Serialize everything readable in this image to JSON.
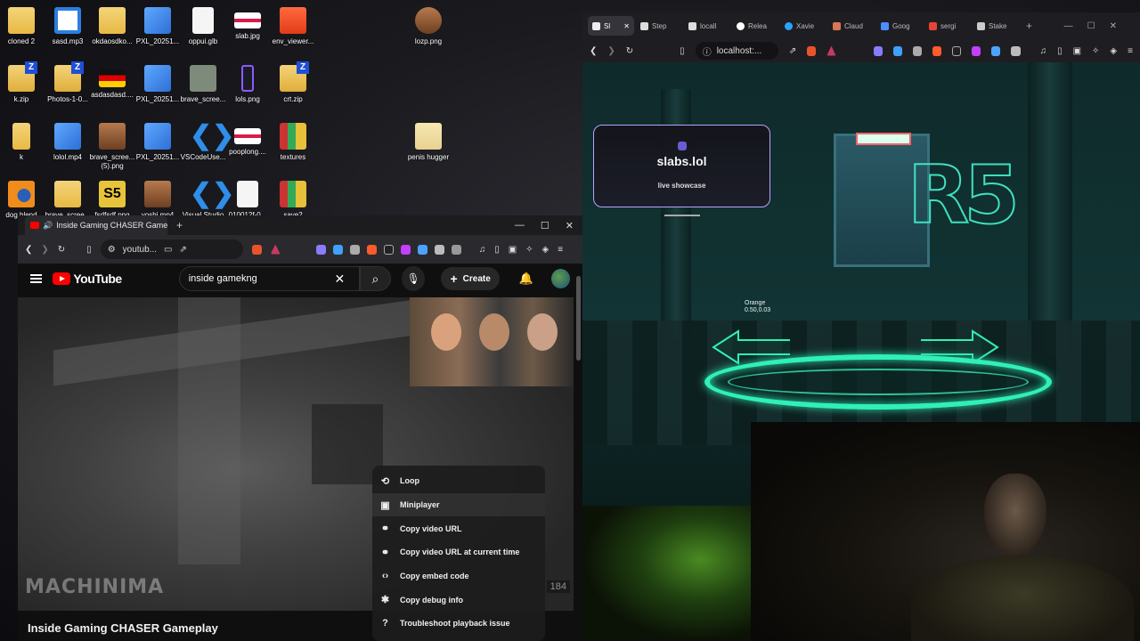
{
  "desktop": {
    "icons": [
      {
        "label": "cloned 2",
        "icon": "folder-icon"
      },
      {
        "label": "sasd.mp3",
        "icon": "audio-icon"
      },
      {
        "label": "okdaosdko...",
        "icon": "file-icon"
      },
      {
        "label": "PXL_20251...",
        "icon": "image-icon"
      },
      {
        "label": "oppui.glb",
        "icon": "file-icon"
      },
      {
        "label": "slab.jpg",
        "icon": "image-icon"
      },
      {
        "label": "env_viewer...",
        "icon": "brave-icon"
      },
      {
        "label": "lozp.png",
        "icon": "image-icon"
      },
      {
        "label": "k.zip",
        "icon": "zip-icon"
      },
      {
        "label": "Photos-1-0...",
        "icon": "zip-icon"
      },
      {
        "label": "asdasdasd....",
        "icon": "image-icon"
      },
      {
        "label": "PXL_20251...",
        "icon": "image-icon"
      },
      {
        "label": "brave_scree...",
        "icon": "image-icon"
      },
      {
        "label": "lols.png",
        "icon": "image-icon"
      },
      {
        "label": "crt.zip",
        "icon": "zip-icon"
      },
      {
        "label": "k",
        "icon": "file-icon"
      },
      {
        "label": "lolol.mp4",
        "icon": "image-icon"
      },
      {
        "label": "brave_scree...\n(5).png",
        "icon": "image-icon"
      },
      {
        "label": "PXL_20251...",
        "icon": "image-icon"
      },
      {
        "label": "VSCodeUse...",
        "icon": "vscode-icon"
      },
      {
        "label": "pooplong....",
        "icon": "image-icon"
      },
      {
        "label": "textures",
        "icon": "folder-icon"
      },
      {
        "label": "penis hugger",
        "icon": "folder-icon"
      },
      {
        "label": "dog.blend",
        "icon": "blender-icon"
      },
      {
        "label": "brave_scree...",
        "icon": "image-icon"
      },
      {
        "label": "fsdfsdf.png",
        "icon": "image-icon"
      },
      {
        "label": "yoshi.mp4",
        "icon": "image-icon"
      },
      {
        "label": "Visual Studio",
        "icon": "vscode-icon"
      },
      {
        "label": "010012f-0...",
        "icon": "file-icon"
      },
      {
        "label": "save2",
        "icon": "zip-icon"
      }
    ]
  },
  "left_browser": {
    "tab_title": "Inside Gaming CHASER Game",
    "url": "youtub...",
    "window_controls": {
      "minimize": "—",
      "maximize": "☐",
      "close": "✕"
    },
    "youtube": {
      "logo_text": "YouTube",
      "search_value": "inside gamekng",
      "create_label": "Create",
      "video_title": "Inside Gaming CHASER Gameplay",
      "watermark": "MACHINIMA",
      "hud_number": "184",
      "context_menu": [
        {
          "label": "Loop",
          "icon": "loop-icon"
        },
        {
          "label": "Miniplayer",
          "icon": "miniplayer-icon"
        },
        {
          "label": "Copy video URL",
          "icon": "link-icon"
        },
        {
          "label": "Copy video URL at current time",
          "icon": "link-icon"
        },
        {
          "label": "Copy embed code",
          "icon": "code-icon"
        },
        {
          "label": "Copy debug info",
          "icon": "bug-icon"
        },
        {
          "label": "Troubleshoot playback issue",
          "icon": "help-icon"
        }
      ]
    }
  },
  "right_browser": {
    "tabs": [
      {
        "label": "Sl",
        "active": true
      },
      {
        "label": "Step"
      },
      {
        "label": "locall"
      },
      {
        "label": "Relea"
      },
      {
        "label": "Xavie"
      },
      {
        "label": "Claud"
      },
      {
        "label": "Goog"
      },
      {
        "label": "sergi"
      },
      {
        "label": "Stake"
      }
    ],
    "url": "localhost:...",
    "showcase": {
      "name": "slabs.lol",
      "subtitle": "live showcase"
    },
    "scene": {
      "logo": "R5",
      "object_label": "Orange",
      "object_coords": "0.50,0.03"
    }
  },
  "colors": {
    "youtube_red": "#ff0000",
    "neon_green": "#2ff0b8",
    "showcase_border": "#b8a2ff"
  }
}
